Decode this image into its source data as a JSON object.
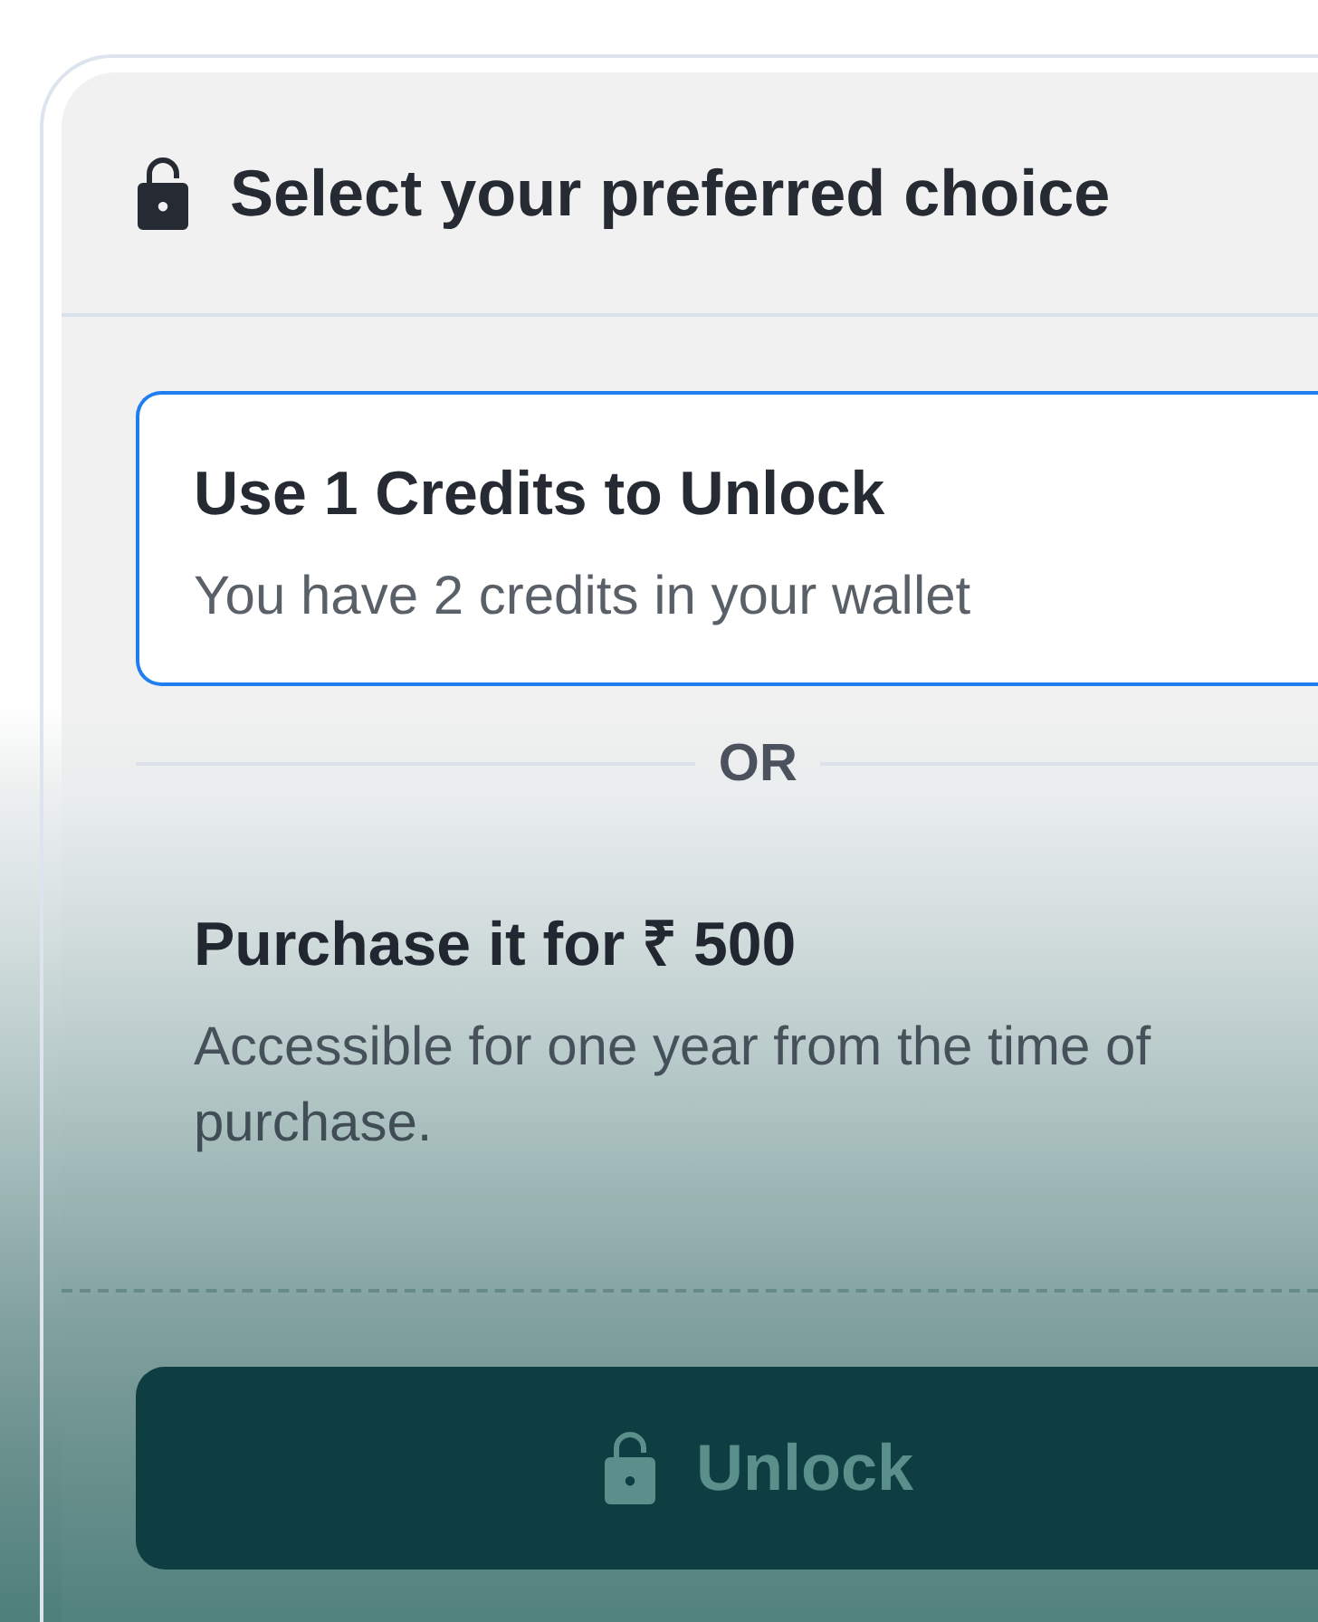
{
  "header": {
    "title": "Select your preferred choice"
  },
  "options": [
    {
      "title": "Use 1 Credits to Unlock",
      "description": "You have 2 credits in your wallet",
      "selected": true
    },
    {
      "title": "Purchase it for ₹ 500",
      "description": "Accessible for one year from the time of purchase.",
      "selected": false
    }
  ],
  "separator": {
    "label": "OR"
  },
  "unlock_button": {
    "label": "Unlock",
    "disabled": true
  }
}
